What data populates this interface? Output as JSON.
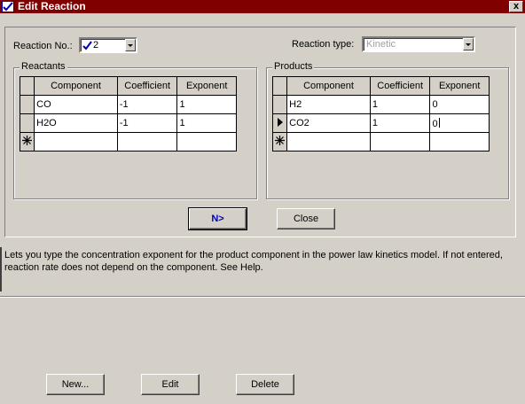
{
  "window": {
    "title": "Edit Reaction",
    "close_symbol": "x"
  },
  "reaction": {
    "no_label": "Reaction No.:",
    "no_value": "2",
    "type_label": "Reaction type:",
    "type_value": "Kinetic"
  },
  "reactants": {
    "label": "Reactants",
    "headers": [
      "Component",
      "Coefficient",
      "Exponent"
    ],
    "rows": [
      {
        "component": "CO",
        "coefficient": "-1",
        "exponent": "1"
      },
      {
        "component": "H2O",
        "coefficient": "-1",
        "exponent": "1"
      }
    ]
  },
  "products": {
    "label": "Products",
    "headers": [
      "Component",
      "Coefficient",
      "Exponent"
    ],
    "rows": [
      {
        "component": "H2",
        "coefficient": "1",
        "exponent": "0"
      },
      {
        "component": "CO2",
        "coefficient": "1",
        "exponent": "0"
      }
    ]
  },
  "buttons": {
    "next": "N>",
    "close": "Close",
    "new": "New...",
    "edit": "Edit",
    "delete": "Delete"
  },
  "help_text": "Lets you type the concentration exponent for the product component in the power law kinetics model. If not entered, reaction rate does not depend on the component. See Help.",
  "colors": {
    "titlebar": "#800000",
    "face": "#d4d0c8",
    "accent": "#0000c0"
  }
}
